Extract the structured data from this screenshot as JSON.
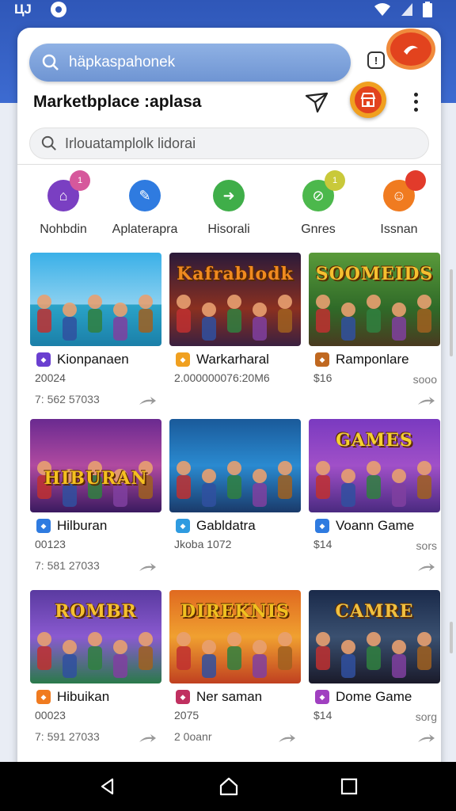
{
  "status_bar": {
    "left_text": "ЦJ",
    "icons": [
      "notification-icon",
      "wifi-icon",
      "signal-icon",
      "battery-icon"
    ]
  },
  "top_search": {
    "value": "häpkaspahonek",
    "icon": "search-icon"
  },
  "header": {
    "title": "Marketbplace :aplasa",
    "icons": [
      "send-icon",
      "store-icon",
      "more-icon"
    ]
  },
  "sub_search": {
    "value": "Irlouatamplolk lidorai",
    "icon": "search-icon"
  },
  "categories": [
    {
      "label": "Nohbdin",
      "color": "#7a3fc2",
      "badge": "1",
      "badge_color": "#d6589c"
    },
    {
      "label": "Aplaterapra",
      "color": "#2f7be0"
    },
    {
      "label": "Hisorali",
      "color": "#3fae49"
    },
    {
      "label": "Gnres",
      "color": "#4cb84c",
      "badge": "1",
      "badge_color": "#c9c93a"
    },
    {
      "label": "Issnan",
      "color": "#f07b20",
      "badge": "",
      "badge_color": "#e23b2b"
    }
  ],
  "cards": [
    {
      "thumb_text": "",
      "name": "Kionpanaen",
      "line1": "20024",
      "line2": "7: 562 57033",
      "right": "",
      "icon_color": "#6a3fd0",
      "thumb_bg": "linear-gradient(#3ab0e8 0%,#8ad0f0 55%,#2aa3c8 56%,#1b7fa8 100%)"
    },
    {
      "thumb_text": "Kafrablodk",
      "name": "Warkarharal",
      "line1": "2.000000076:20M6",
      "line2": "",
      "right": "",
      "icon_color": "#f0a020",
      "thumb_bg": "linear-gradient(#2a1a3a,#8a3020 60%,#3a2040)"
    },
    {
      "thumb_text": "SOOMEIDS",
      "name": "Ramponlare",
      "line1": "$16",
      "line2": "",
      "right": "sooo",
      "icon_color": "#c06820",
      "thumb_bg": "linear-gradient(#5a9a3a,#2f6a28 60%,#4a3a20)"
    },
    {
      "thumb_text": "HIBURAN",
      "name": "Hilburan",
      "line1": "00123",
      "line2": "7: 581 27033",
      "right": "",
      "icon_color": "#2f7be0",
      "thumb_bg": "linear-gradient(#6a2a90,#b04aa0 50%,#3a1a60)"
    },
    {
      "thumb_text": "",
      "name": "Gabldatra",
      "line1": "Jkoba 1072",
      "line2": "",
      "right": "",
      "icon_color": "#2f9be0",
      "thumb_bg": "linear-gradient(#1a5a9a,#2a8ad0 50%,#1a3a6a)"
    },
    {
      "thumb_text": "GAMES",
      "name": "Voann Game",
      "line1": "$14",
      "line2": "",
      "right": "sors",
      "icon_color": "#2f7be0",
      "thumb_bg": "linear-gradient(#7a3ac0,#a050c8 50%,#4a2a80)"
    },
    {
      "thumb_text": "ROMBR",
      "name": "Hibuikan",
      "line1": "00023",
      "line2": "7: 591 27033",
      "right": "",
      "icon_color": "#f07b20",
      "thumb_bg": "linear-gradient(#5a3aa0,#8a5ad0 50%,#2a7a4a)"
    },
    {
      "thumb_text": "DIREKNIS",
      "name": "Ner saman",
      "line1": "2075",
      "line2": "2 0oanr",
      "right": "",
      "icon_color": "#c03060",
      "thumb_bg": "linear-gradient(#e06a20,#f0a030 50%,#c04020)"
    },
    {
      "thumb_text": "CAMRE",
      "name": "Dome Game",
      "line1": "$14",
      "line2": "",
      "right": "sorg",
      "icon_color": "#a040c0",
      "thumb_bg": "linear-gradient(#1a2a4a,#3a5070 50%,#1a1a2a)"
    }
  ],
  "nav": {
    "icons": [
      "back-icon",
      "home-icon",
      "recents-icon"
    ]
  }
}
